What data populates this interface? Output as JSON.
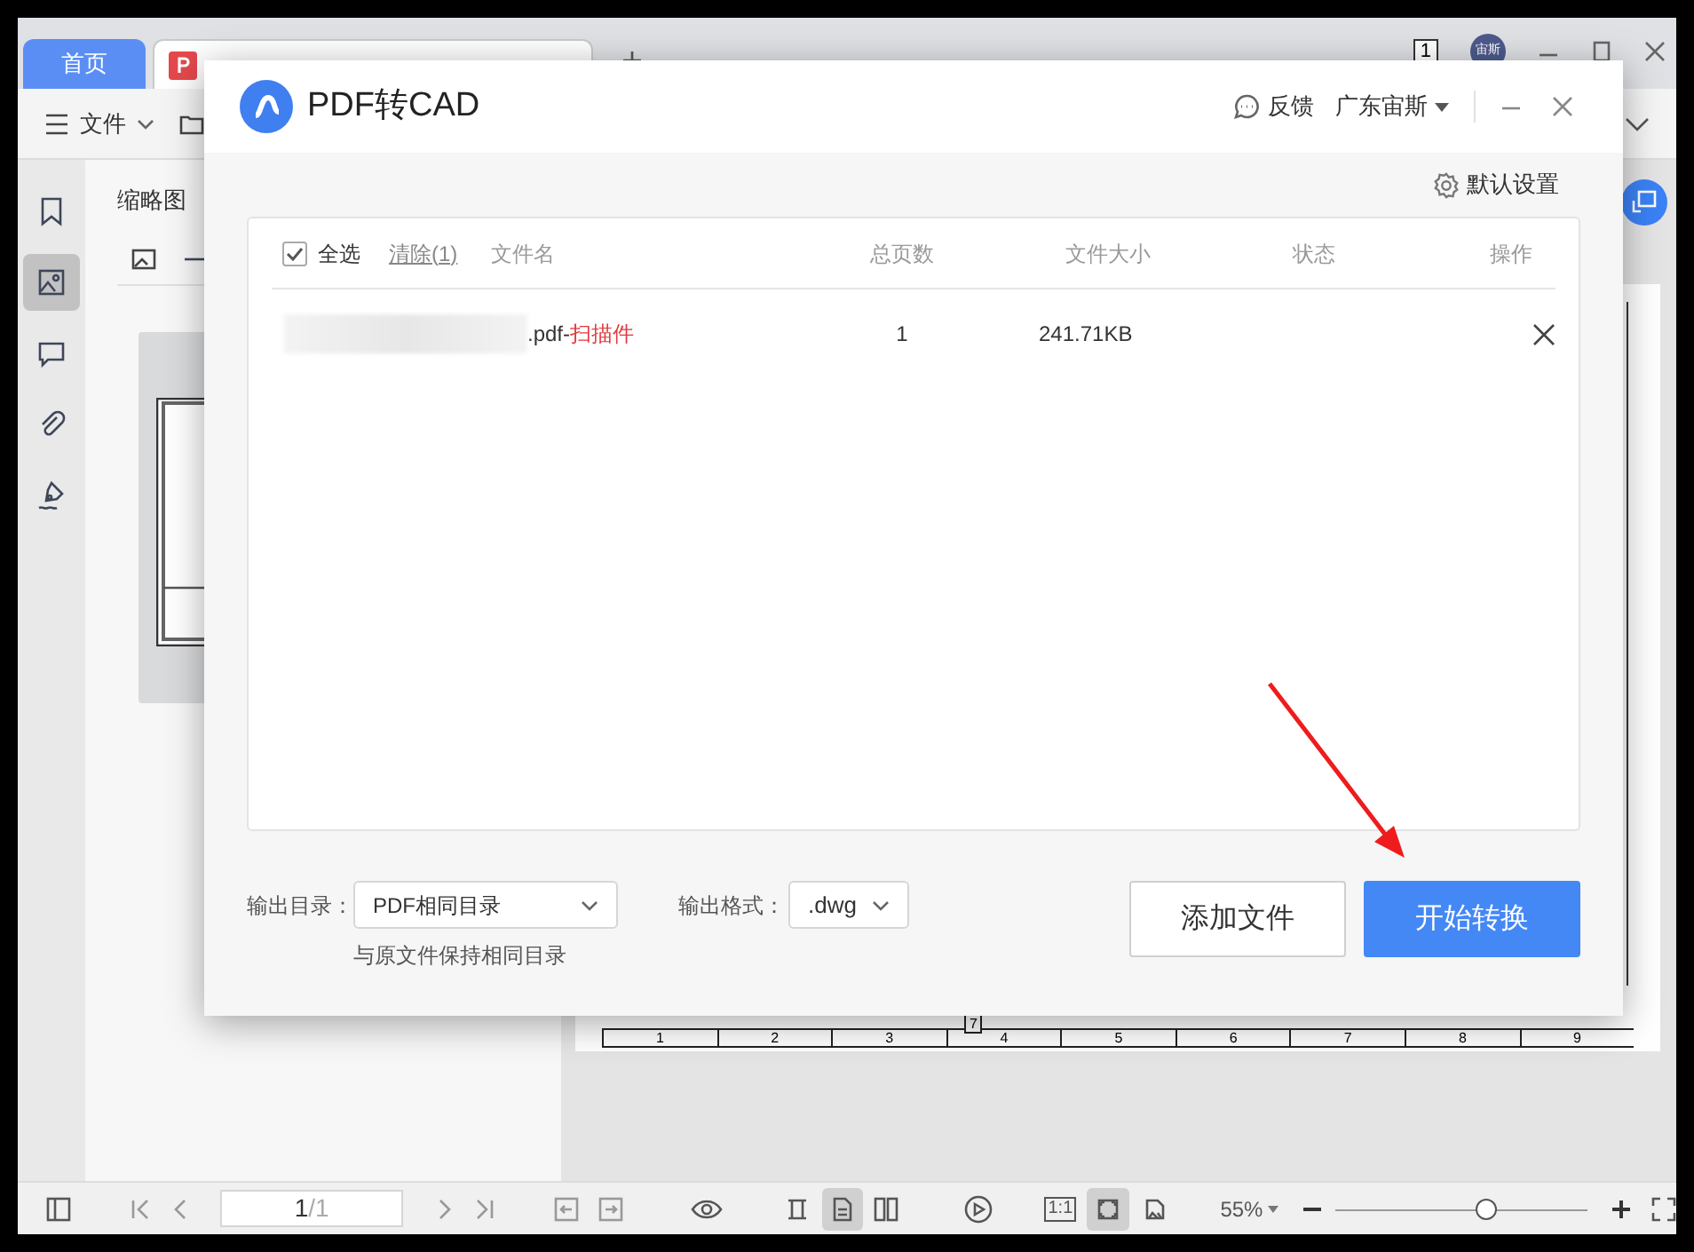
{
  "app_tabs": [
    {
      "kind": "home",
      "label": "首页"
    },
    {
      "kind": "document"
    }
  ],
  "title_bar": {
    "page_badge": "1",
    "avatar_text": "宙斯"
  },
  "toolbar": {
    "menu": "文件"
  },
  "left_rail": [
    {
      "selected": false
    },
    {
      "selected": true
    },
    {
      "selected": false
    },
    {
      "selected": false
    },
    {
      "selected": false
    }
  ],
  "thumbnail_panel": {
    "title": "缩略图"
  },
  "document": {
    "ruler": [
      "1",
      "2",
      "3",
      "4",
      "5",
      "6",
      "7",
      "8",
      "9"
    ],
    "cell_label": "7"
  },
  "dialog": {
    "title": "PDF转CAD",
    "feedback": "反馈",
    "account": "广东宙斯",
    "settings": "默认设置",
    "select_all": {
      "label": "全选",
      "checked": true
    },
    "clear": "清除(1)",
    "columns": [
      "文件名",
      "总页数",
      "文件大小",
      "状态",
      "操作"
    ],
    "files": [
      {
        "name": ".pdf-",
        "tag": "扫描件",
        "pages": "1",
        "size": "241.71KB"
      }
    ],
    "output_dir_label": "输出目录：",
    "output_dir": "PDF相同目录",
    "output_dir_hint": "与原文件保持相同目录",
    "format_label": "输出格式：",
    "format": ".dwg",
    "add_button": "添加文件",
    "start_button": "开始转换"
  },
  "status_bar": {
    "page_current": "1",
    "page_total": "/1",
    "view_modes": [
      {
        "selected": false
      },
      {
        "selected": true
      },
      {
        "selected": false
      }
    ],
    "fit_modes": [
      {
        "kind": "text",
        "label": "1:1",
        "selected": false
      },
      {
        "kind": "icon",
        "selected": true
      },
      {
        "kind": "icon",
        "selected": false
      }
    ],
    "zoom": "55%",
    "zoom_slider": {
      "level": 0.6
    }
  }
}
